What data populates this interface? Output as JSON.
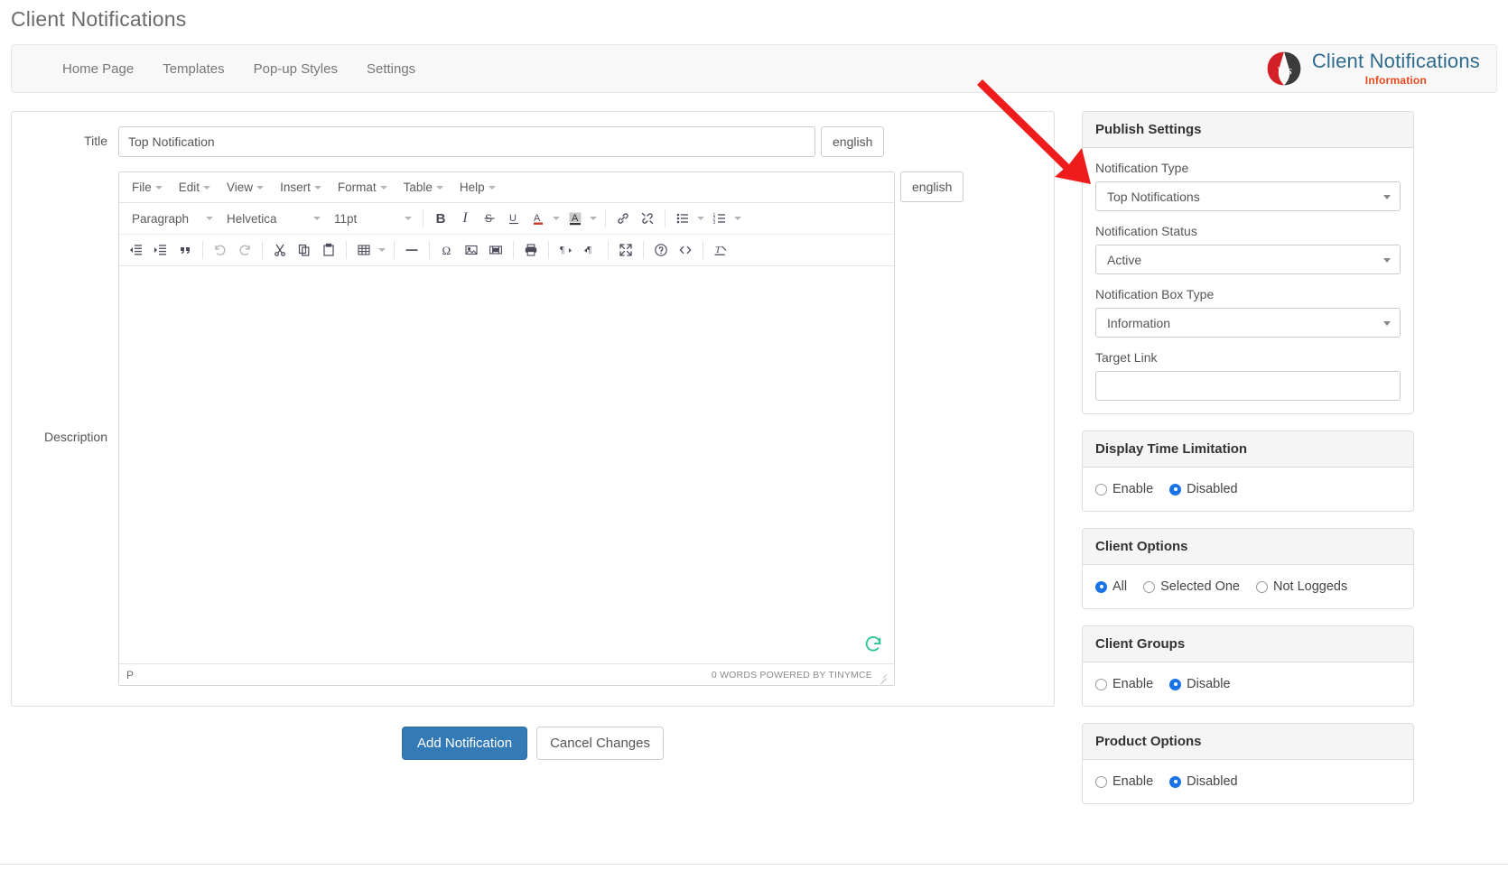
{
  "page": {
    "title": "Client Notifications"
  },
  "nav": {
    "items": [
      {
        "label": "Home Page"
      },
      {
        "label": "Templates"
      },
      {
        "label": "Pop-up Styles"
      },
      {
        "label": "Settings"
      }
    ]
  },
  "brand": {
    "title": "Client Notifications",
    "subtitle": "Information",
    "logo_letters": "ws",
    "logo_red": "#d32027",
    "logo_dark": "#3b3b3b",
    "title_color": "#2e6b8e",
    "subtitle_color": "#e8491d"
  },
  "form": {
    "title_label": "Title",
    "title_value": "Top Notification",
    "title_lang_badge": "english",
    "description_label": "Description",
    "description_lang_badge": "english"
  },
  "editor": {
    "menubar": [
      {
        "label": "File"
      },
      {
        "label": "Edit"
      },
      {
        "label": "View"
      },
      {
        "label": "Insert"
      },
      {
        "label": "Format"
      },
      {
        "label": "Table"
      },
      {
        "label": "Help"
      }
    ],
    "style_select": "Paragraph",
    "font_select": "Helvetica",
    "size_select": "11pt",
    "toolbar_row1": [
      "bold-icon",
      "italic-icon",
      "strikethrough-icon",
      "underline-icon",
      "text-color-icon",
      "background-color-icon",
      "link-icon",
      "unlink-icon",
      "bullet-list-icon",
      "numbered-list-icon"
    ],
    "toolbar_row2": [
      "outdent-icon",
      "indent-icon",
      "blockquote-icon",
      "undo-icon",
      "redo-icon",
      "cut-icon",
      "copy-icon",
      "paste-icon",
      "table-icon",
      "horizontal-rule-icon",
      "special-character-icon",
      "image-icon",
      "media-icon",
      "print-icon",
      "ltr-icon",
      "rtl-icon",
      "fullscreen-icon",
      "help-icon",
      "source-code-icon",
      "clear-formatting-icon"
    ],
    "body_text": "",
    "status_path": "P",
    "status_words": "0 WORDS POWERED BY TINYMCE"
  },
  "actions": {
    "submit_label": "Add Notification",
    "cancel_label": "Cancel Changes"
  },
  "sidebar": {
    "panels": [
      {
        "heading": "Publish Settings",
        "type": "fields",
        "fields": [
          {
            "label": "Notification Type",
            "control": "select",
            "value": "Top Notifications"
          },
          {
            "label": "Notification Status",
            "control": "select",
            "value": "Active"
          },
          {
            "label": "Notification Box Type",
            "control": "select",
            "value": "Information"
          },
          {
            "label": "Target Link",
            "control": "input",
            "value": "",
            "placeholder": ""
          }
        ]
      },
      {
        "heading": "Display Time Limitation",
        "type": "radios",
        "options": [
          {
            "label": "Enable",
            "checked": false
          },
          {
            "label": "Disabled",
            "checked": true
          }
        ]
      },
      {
        "heading": "Client Options",
        "type": "radios",
        "options": [
          {
            "label": "All",
            "checked": true
          },
          {
            "label": "Selected One",
            "checked": false
          },
          {
            "label": "Not Loggeds",
            "checked": false
          }
        ]
      },
      {
        "heading": "Client Groups",
        "type": "radios",
        "options": [
          {
            "label": "Enable",
            "checked": false
          },
          {
            "label": "Disable",
            "checked": true
          }
        ]
      },
      {
        "heading": "Product Options",
        "type": "radios",
        "options": [
          {
            "label": "Enable",
            "checked": false
          },
          {
            "label": "Disabled",
            "checked": true
          }
        ]
      }
    ]
  },
  "annotation": {
    "arrow_color": "#ee1c1c",
    "points_to": "Notification Type select"
  },
  "colors": {
    "primary_button": "#337ab7",
    "radio_selected": "#1a73e8",
    "panel_header_bg": "#f5f5f5"
  }
}
